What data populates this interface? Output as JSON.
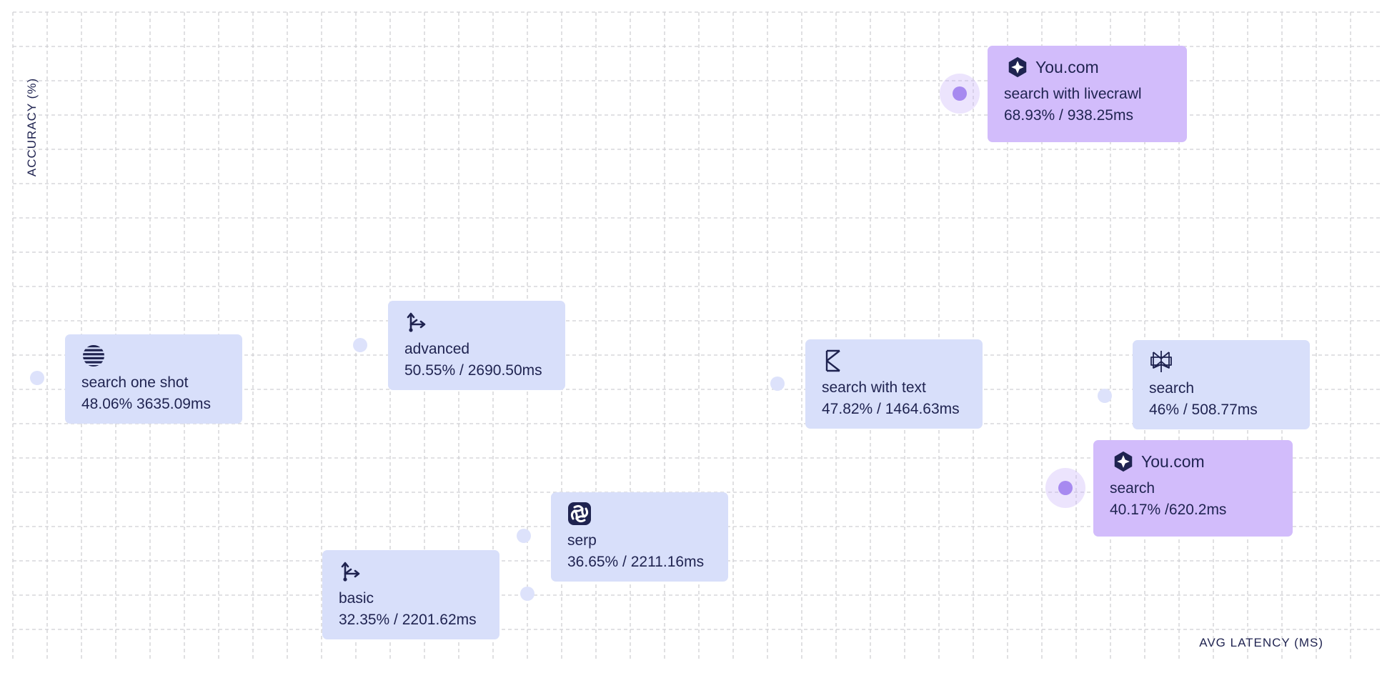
{
  "colors": {
    "grid": "#cfcfd3",
    "dot": "#dde2fb",
    "card": "#d8dffa",
    "highlight_card": "#d2bcfb",
    "highlight_dot": "#a78af0",
    "text": "#1f2350"
  },
  "chart_data": {
    "type": "scatter",
    "title": "",
    "xlabel": "AVG LATENCY (MS)",
    "ylabel": "ACCURACY (%)",
    "grid": true,
    "legend": "none",
    "points": [
      {
        "name": "search with livecrawl",
        "brand": "You.com",
        "accuracy": 68.93,
        "latency_ms": 938.25,
        "metric_text": "68.93% / 938.25ms",
        "icon": "you-com-logo-icon",
        "highlight": true
      },
      {
        "name": "search",
        "brand": "You.com",
        "accuracy": 40.17,
        "latency_ms": 620.2,
        "metric_text": "40.17% /620.2ms",
        "icon": "you-com-logo-icon",
        "highlight": true
      },
      {
        "name": "search one shot",
        "accuracy": 48.06,
        "latency_ms": 3635.09,
        "metric_text": "48.06% 3635.09ms",
        "icon": "striped-globe-icon",
        "highlight": false
      },
      {
        "name": "advanced",
        "accuracy": 50.55,
        "latency_ms": 2690.5,
        "metric_text": "50.55% / 2690.50ms",
        "icon": "branch-arrows-icon",
        "highlight": false
      },
      {
        "name": "search with text",
        "accuracy": 47.82,
        "latency_ms": 1464.63,
        "metric_text": "47.82% / 1464.63ms",
        "icon": "hourglass-k-icon",
        "highlight": false
      },
      {
        "name": "search",
        "accuracy": 46,
        "latency_ms": 508.77,
        "metric_text": "46% / 508.77ms",
        "icon": "star-lattice-icon",
        "highlight": false
      },
      {
        "name": "serp",
        "accuracy": 36.65,
        "latency_ms": 2211.16,
        "metric_text": "36.65% / 2211.16ms",
        "icon": "swirl-square-icon",
        "highlight": false
      },
      {
        "name": "basic",
        "accuracy": 32.35,
        "latency_ms": 2201.62,
        "metric_text": "32.35% / 2201.62ms",
        "icon": "branch-arrows-icon",
        "highlight": false
      }
    ]
  }
}
